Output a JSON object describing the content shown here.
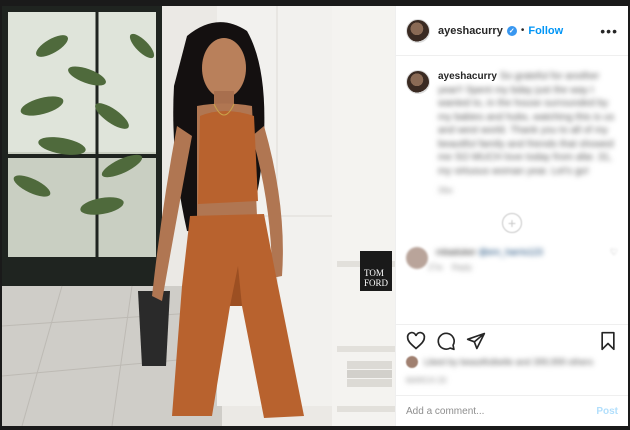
{
  "header": {
    "username": "ayeshacurry",
    "separator": "•",
    "follow_label": "Follow",
    "more_label": "•••"
  },
  "caption": {
    "username": "ayeshacurry",
    "text": "So grateful for another year!! Spent my bday just the way I wanted to, in the house surrounded by my babies and hubs, watching this is us and west world. Thank you to all of my beautiful family and friends that showed me SO MUCH love today from afar. 31, my virtuous woman year. Let's go!",
    "time": "39w"
  },
  "comment": {
    "username": "mbaduker",
    "mention": "@em_harris123",
    "meta_time": "27w",
    "meta_reply": "Reply"
  },
  "actions": {
    "like": "heart-icon",
    "comment": "comment-icon",
    "share": "share-icon",
    "save": "bookmark-icon"
  },
  "likes": {
    "text": "Liked by beautifulbelle and 399,999 others"
  },
  "date": "MARCH 20",
  "add_comment": {
    "placeholder": "Add a comment...",
    "post_label": "Post"
  },
  "colors": {
    "accent": "#0095f6",
    "post_disabled": "#b2dffc",
    "outfit": "#b8622e"
  }
}
